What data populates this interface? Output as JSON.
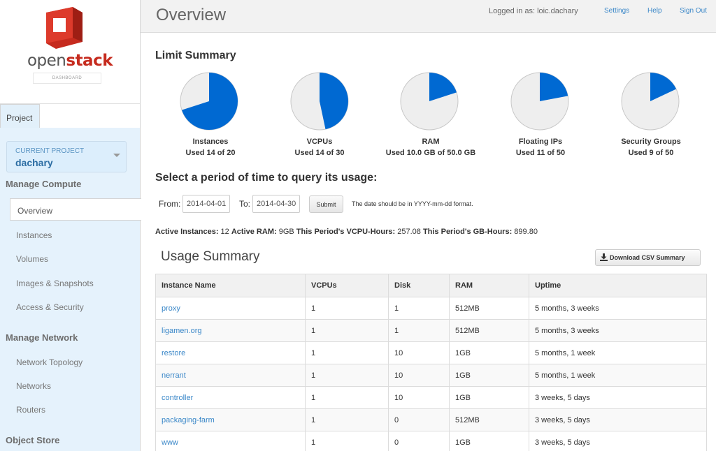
{
  "header": {
    "title": "Overview",
    "logged_in": "Logged in as: loic.dachary",
    "settings": "Settings",
    "help": "Help",
    "sign_out": "Sign Out"
  },
  "logo": {
    "open": "open",
    "stack": "stack",
    "sub": "DASHBOARD",
    "colors": {
      "red": "#c62b1e",
      "gray": "#555555"
    }
  },
  "sidebar": {
    "tab": "Project",
    "current_project_label": "CURRENT PROJECT",
    "current_project": "dachary",
    "sections": [
      {
        "heading": "Manage Compute",
        "items": [
          "Overview",
          "Instances",
          "Volumes",
          "Images & Snapshots",
          "Access & Security"
        ]
      },
      {
        "heading": "Manage Network",
        "items": [
          "Network Topology",
          "Networks",
          "Routers"
        ]
      },
      {
        "heading": "Object Store",
        "items": []
      }
    ],
    "active": "Overview"
  },
  "limits": {
    "title": "Limit Summary",
    "accent": "#0069d2",
    "items": [
      {
        "name": "Instances",
        "usage": "Used 14 of 20",
        "used": 14,
        "total": 20
      },
      {
        "name": "VCPUs",
        "usage": "Used 14 of 30",
        "used": 14,
        "total": 30
      },
      {
        "name": "RAM",
        "usage": "Used 10.0 GB of 50.0 GB",
        "used": 10,
        "total": 50
      },
      {
        "name": "Floating IPs",
        "usage": "Used 11 of 50",
        "used": 11,
        "total": 50
      },
      {
        "name": "Security Groups",
        "usage": "Used 9 of 50",
        "used": 9,
        "total": 50
      }
    ]
  },
  "period": {
    "title": "Select a period of time to query its usage:",
    "from_label": "From:",
    "from_value": "2014-04-01",
    "to_label": "To:",
    "to_value": "2014-04-30",
    "submit": "Submit",
    "hint": "The date should be in YYYY-mm-dd format."
  },
  "stats": {
    "active_instances_label": "Active Instances:",
    "active_instances": "12",
    "active_ram_label": "Active RAM:",
    "active_ram": "9GB",
    "vcpu_hours_label": "This Period's VCPU-Hours:",
    "vcpu_hours": "257.08",
    "gb_hours_label": "This Period's GB-Hours:",
    "gb_hours": "899.80"
  },
  "usage": {
    "title": "Usage Summary",
    "download": "Download CSV Summary",
    "columns": [
      "Instance Name",
      "VCPUs",
      "Disk",
      "RAM",
      "Uptime"
    ],
    "rows": [
      [
        "proxy",
        "1",
        "1",
        "512MB",
        "5 months, 3 weeks"
      ],
      [
        "ligamen.org",
        "1",
        "1",
        "512MB",
        "5 months, 3 weeks"
      ],
      [
        "restore",
        "1",
        "10",
        "1GB",
        "5 months, 1 week"
      ],
      [
        "nerrant",
        "1",
        "10",
        "1GB",
        "5 months, 1 week"
      ],
      [
        "controller",
        "1",
        "10",
        "1GB",
        "3 weeks, 5 days"
      ],
      [
        "packaging-farm",
        "1",
        "0",
        "512MB",
        "3 weeks, 5 days"
      ],
      [
        "www",
        "1",
        "0",
        "1GB",
        "3 weeks, 5 days"
      ]
    ]
  }
}
